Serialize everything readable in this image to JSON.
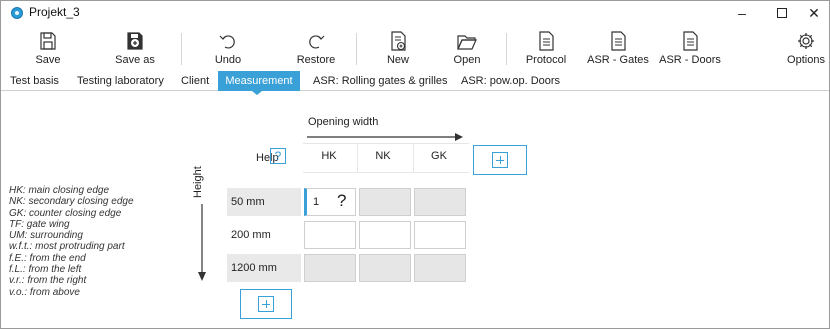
{
  "window": {
    "title": "Projekt_3",
    "controls": {
      "minimize": "–",
      "close": "✕"
    }
  },
  "toolbar": {
    "save": "Save",
    "save_as": "Save as",
    "undo": "Undo",
    "restore": "Restore",
    "new": "New",
    "open": "Open",
    "protocol": "Protocol",
    "asr_gates": "ASR - Gates",
    "asr_doors": "ASR - Doors",
    "options": "Options"
  },
  "tabs": [
    {
      "label": "Test basis"
    },
    {
      "label": "Testing laboratory"
    },
    {
      "label": "Client"
    },
    {
      "label": "Measurement",
      "active": true
    },
    {
      "label": "ASR: Rolling gates & grilles"
    },
    {
      "label": "ASR: pow.op. Doors"
    }
  ],
  "measurement": {
    "opening_width_label": "Opening width",
    "help_label": "Help",
    "help_icon": "?",
    "height_label": "Height",
    "columns": [
      "HK",
      "NK",
      "GK"
    ],
    "rows": [
      {
        "label": "50 mm",
        "cells": [
          "1",
          "",
          ""
        ]
      },
      {
        "label": "200 mm",
        "cells": [
          "",
          "",
          ""
        ]
      },
      {
        "label": "1200 mm",
        "cells": [
          "",
          "",
          ""
        ]
      }
    ],
    "cell_help_icon": "?"
  },
  "legend": [
    "HK: main closing edge",
    "NK: secondary closing edge",
    "GK: counter closing edge",
    "TF: gate wing",
    "UM: surrounding",
    "w.f.t.: most protruding part",
    "f.E.: from the end",
    "f.L.: from the left",
    "v.r.: from the right",
    "v.o.: from above"
  ],
  "colors": {
    "accent": "#3aa0d8",
    "cell_shaded": "#e6e6e6",
    "row_label_bg": "#e9e9e9"
  }
}
